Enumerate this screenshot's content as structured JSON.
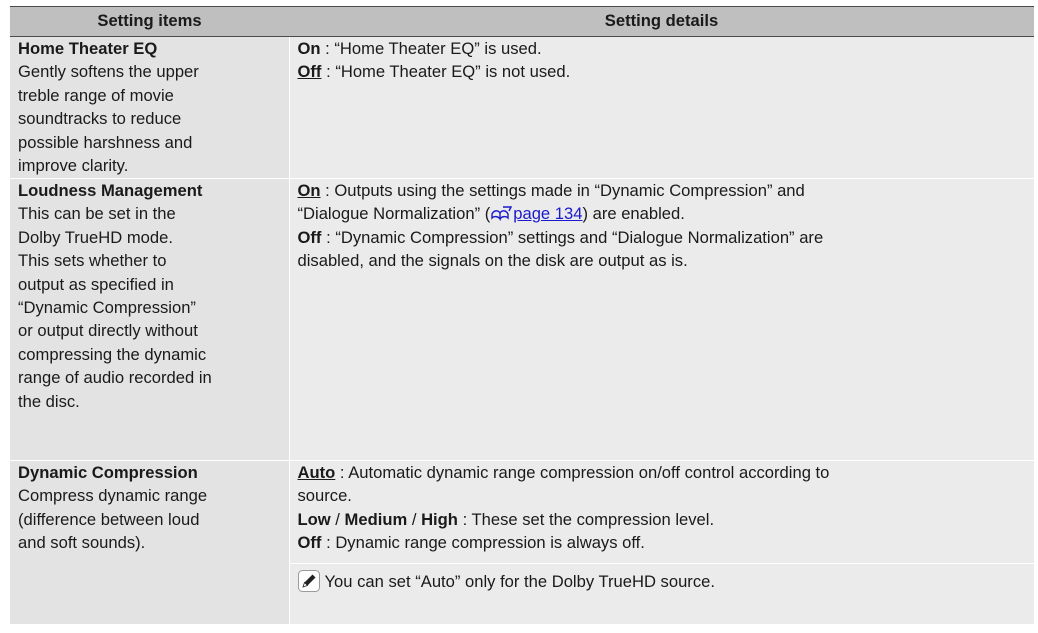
{
  "header": {
    "col1": "Setting items",
    "col2": "Setting details"
  },
  "rows": [
    {
      "title": "Home Theater EQ",
      "desc_lines": [
        "Gently softens the upper",
        "treble range of movie",
        "soundtracks to reduce",
        "possible harshness and",
        "improve clarity."
      ],
      "details": [
        {
          "key": "On",
          "sep": " : ",
          "text": "“Home Theater EQ” is used."
        },
        {
          "key": "Off",
          "sep": " : ",
          "text": "“Home Theater EQ” is not used."
        }
      ]
    },
    {
      "title": "Loudness Management",
      "desc_lines": [
        "This can be set in the",
        "Dolby TrueHD mode.",
        "This sets whether to",
        "output as specified in",
        "“Dynamic Compression”",
        "or output directly without",
        "compressing the dynamic",
        "range of audio recorded in",
        "the disc."
      ],
      "details": [
        {
          "key": "On",
          "sep": " : ",
          "line1": "Outputs using the settings made in “Dynamic Compression” and",
          "line2_pre": "“Dialogue Normalization” (",
          "link": "page 134",
          "line2_post": ") are enabled."
        },
        {
          "key": "Off",
          "sep": " : ",
          "line1": "“Dynamic Compression” settings and “Dialogue Normalization” are",
          "line2": "disabled, and the signals on the disk are output as is."
        }
      ]
    },
    {
      "title": "Dynamic Compression",
      "desc_lines": [
        "Compress dynamic range",
        "(difference between loud",
        "and soft sounds)."
      ],
      "details": [
        {
          "key": "Auto",
          "sep": " : ",
          "line1": "Automatic dynamic range compression on/off control according to",
          "line2": "source."
        },
        {
          "key_a": "Low",
          "slash1": " / ",
          "key_b": "Medium",
          "slash2": " / ",
          "key_c": "High",
          "sep": " : ",
          "text": "These set the compression level."
        },
        {
          "key": "Off",
          "sep": " : ",
          "text": "Dynamic range compression is always off."
        }
      ],
      "note": "You can set “Auto” only for the Dolby TrueHD source.",
      "note_icon": "pencil-icon"
    }
  ]
}
